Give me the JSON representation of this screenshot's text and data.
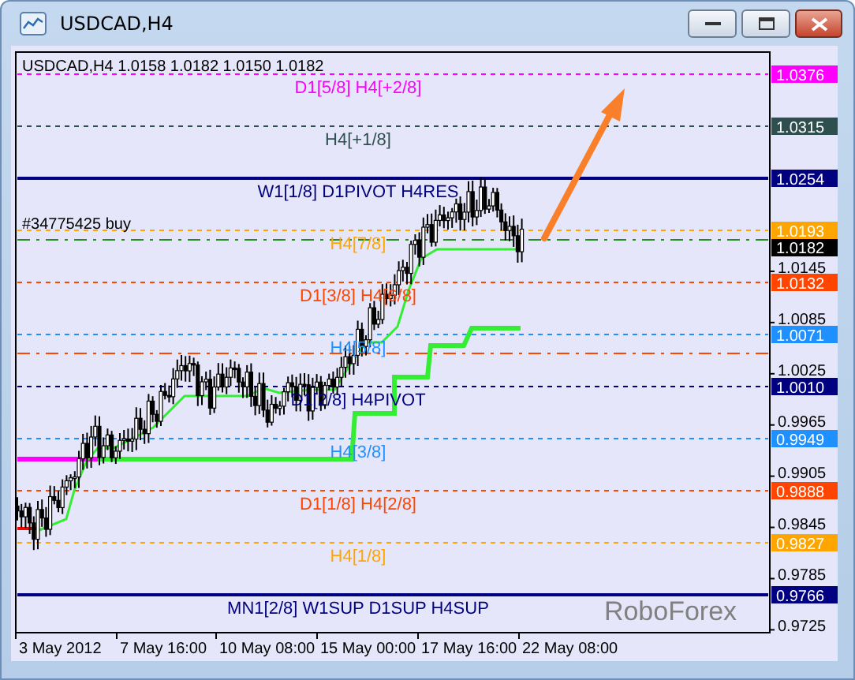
{
  "window": {
    "title": "USDCAD,H4"
  },
  "chart": {
    "header": "USDCAD,H4  1.0158 1.0182 1.0150 1.0182",
    "levels": [
      {
        "label": "D1[5/8] H4[+2/8]",
        "price": "1.0376",
        "color": "#ff00ff",
        "kind": "dashed"
      },
      {
        "label": "H4[+1/8]",
        "price": "1.0315",
        "color": "#2f4f4f",
        "kind": "dashed"
      },
      {
        "label": "W1[1/8] D1PIVOT H4RES",
        "price": "1.0254",
        "color": "#000080",
        "kind": "solid"
      },
      {
        "label": "H4[7/8]",
        "price": "1.0193",
        "color": "#ffa500",
        "kind": "dashed"
      },
      {
        "label": "D1[3/8] H4[6/8]",
        "price": "1.0132",
        "color": "#ff4500",
        "kind": "dashed"
      },
      {
        "label": "H4[5/8]",
        "price": "1.0071",
        "color": "#1e90ff",
        "kind": "dashed"
      },
      {
        "label": "D1[2/8] H4PIVOT",
        "price": "1.0010",
        "color": "#000080",
        "kind": "dashed"
      },
      {
        "label": "H4[3/8]",
        "price": "0.9949",
        "color": "#1e90ff",
        "kind": "dashed"
      },
      {
        "label": "D1[1/8] H4[2/8]",
        "price": "0.9888",
        "color": "#ff4500",
        "kind": "dashed"
      },
      {
        "label": "H4[1/8]",
        "price": "0.9827",
        "color": "#ffa500",
        "kind": "dashed"
      },
      {
        "label": "MN1[2/8] W1SUP D1SUP H4SUP",
        "price": "0.9766",
        "color": "#000080",
        "kind": "solid"
      }
    ],
    "order": {
      "label": "#34775425 buy"
    },
    "current_price": {
      "price": "1.0182"
    },
    "y_ticks": [
      "1.0145",
      "1.0085",
      "1.0025",
      "0.9965",
      "0.9905",
      "0.9845",
      "0.9785",
      "0.9725"
    ],
    "x_ticks": [
      "3 May 2012",
      "7 May 16:00",
      "10 May 08:00",
      "15 May 00:00",
      "17 May 16:00",
      "22 May 08:00"
    ],
    "logo": "RoboForex"
  }
}
